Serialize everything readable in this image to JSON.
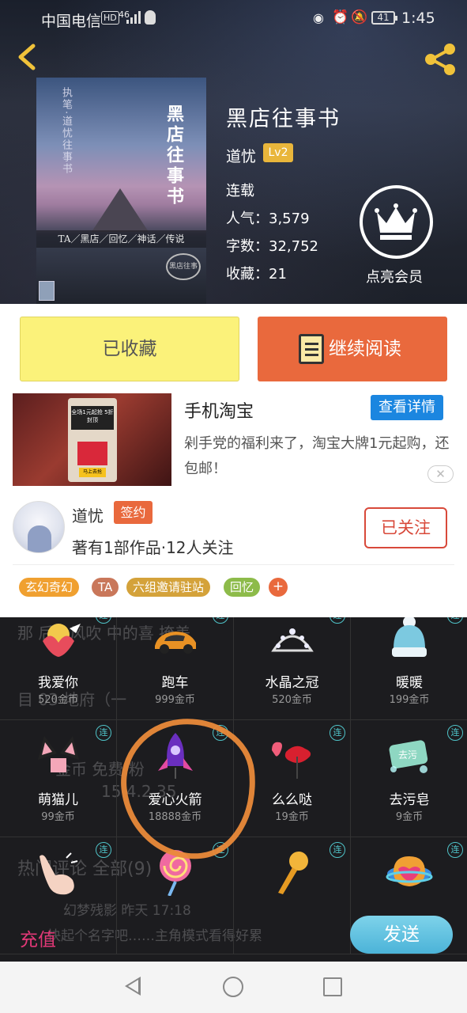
{
  "status_bar": {
    "carrier": "中国电信",
    "hd": "HD",
    "network": "46",
    "battery": "41",
    "time": "1:45"
  },
  "book": {
    "title": "黑店往事书",
    "author": "道忧",
    "level": "Lv2",
    "status": "连载",
    "popularity_label": "人气：",
    "popularity": "3,579",
    "words_label": "字数：",
    "words": "32,752",
    "favorites_label": "收藏：",
    "favorites": "21",
    "vip_label": "点亮会员"
  },
  "cover": {
    "title": "黑店往事书",
    "subtitle": "执笔·道忧往事书",
    "tags": "TA／黑店／回忆／神话／传说",
    "seal": "黑店往事"
  },
  "actions": {
    "collected": "已收藏",
    "continue_read": "继续阅读"
  },
  "ad": {
    "title": "手机淘宝",
    "detail_button": "查看详情",
    "description": "剁手党的福利来了，淘宝大牌1元起购，还包邮！",
    "close": "✕",
    "promo_text": "全场1元起抢 5折封顶",
    "cta": "马上去抢"
  },
  "author_card": {
    "name": "道忧",
    "badge": "签约",
    "stats": "著有1部作品·12人关注",
    "follow_button": "已关注"
  },
  "tags": [
    {
      "label": "玄幻奇幻",
      "color": "#f0a030"
    },
    {
      "label": "TA",
      "color": "#c9775a"
    },
    {
      "label": "六组邀请驻站",
      "color": "#d4a23a"
    },
    {
      "label": "回忆",
      "color": "#8dbb4a"
    }
  ],
  "tag_add": "+",
  "background_ghost": [
    "那      后冷风吹      中的喜      掩盖",
    "目            03        地府（一",
    "金币      免费          粉",
    "15             4.2             35",
    "热门评论                  全部(9)",
    "幻梦残影             昨天 17:18",
    "      快起个名字吧……主角模式看得好累"
  ],
  "gifts": [
    {
      "name": "我爱你",
      "price": "520金币",
      "combo": "连"
    },
    {
      "name": "跑车",
      "price": "999金币",
      "combo": "连"
    },
    {
      "name": "水晶之冠",
      "price": "520金币",
      "combo": "连"
    },
    {
      "name": "暖暖",
      "price": "199金币",
      "combo": "连"
    },
    {
      "name": "萌猫儿",
      "price": "99金币",
      "combo": "连"
    },
    {
      "name": "爱心火箭",
      "price": "18888金币",
      "combo": "连"
    },
    {
      "name": "么么哒",
      "price": "19金币",
      "combo": "连"
    },
    {
      "name": "去污皂",
      "price": "9金币",
      "combo": "连"
    },
    {
      "name": "",
      "price": "",
      "combo": "连"
    },
    {
      "name": "",
      "price": "",
      "combo": "连"
    },
    {
      "name": "",
      "price": "",
      "combo": "连"
    },
    {
      "name": "",
      "price": "",
      "combo": "连"
    }
  ],
  "recharge": "充值",
  "send": "发送",
  "soap_text": "去污",
  "colors": {
    "accent_orange": "#e9693d",
    "collected_yellow": "#fbf27a",
    "ad_blue": "#1b86e0",
    "recharge_pink": "#e23877",
    "send_blue": "#4bb3d8",
    "highlight_orange": "#ea8a3a"
  }
}
